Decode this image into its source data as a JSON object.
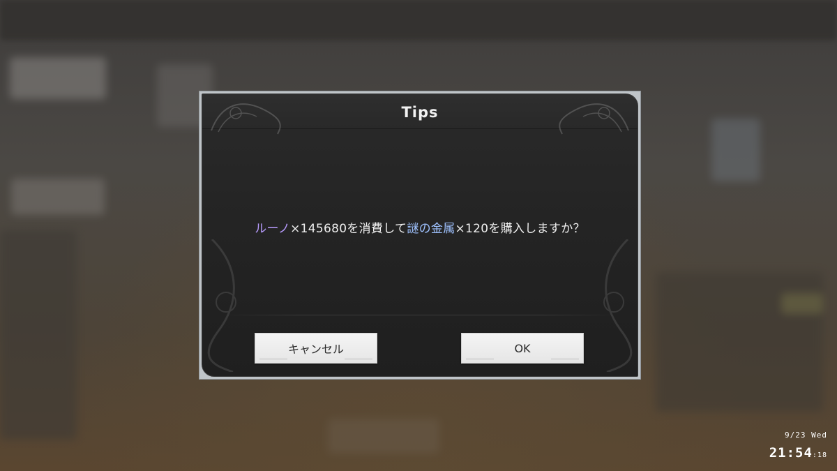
{
  "dialog": {
    "title": "Tips",
    "message": {
      "item1": "ルーノ",
      "part1": "×145680を消費して",
      "item2": "謎の金属",
      "part2": "×120を購入しますか？"
    },
    "cancel_label": "キャンセル",
    "ok_label": "OK"
  },
  "clock": {
    "date": "9/23 Wed",
    "time": "21:54",
    "seconds": "18"
  },
  "colors": {
    "highlight_currency": "#b89cff",
    "highlight_item": "#9fc2ff"
  },
  "icons": [
    "ornament-icon"
  ]
}
